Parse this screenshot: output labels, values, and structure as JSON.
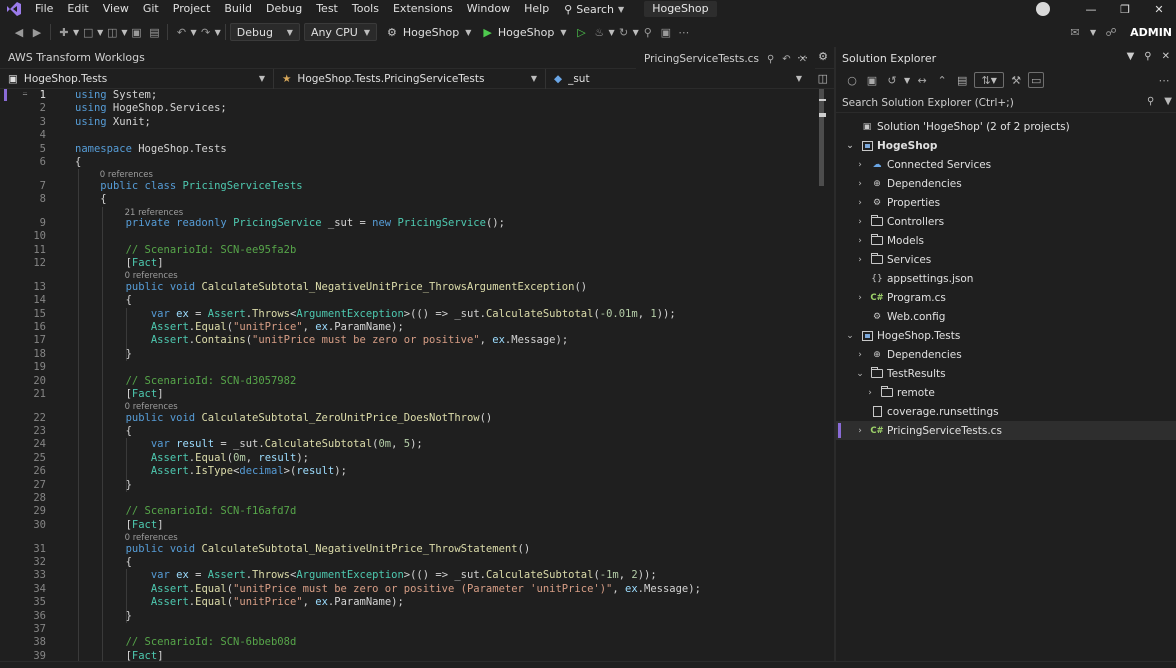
{
  "menu": {
    "items": [
      "File",
      "Edit",
      "View",
      "Git",
      "Project",
      "Build",
      "Debug",
      "Test",
      "Tools",
      "Extensions",
      "Window",
      "Help"
    ],
    "search_label": "Search",
    "solution_title": "HogeShop"
  },
  "toolbar": {
    "config": "Debug",
    "platform": "Any CPU",
    "startup_project": "HogeShop",
    "run_target": "HogeShop",
    "account": "ADMIN"
  },
  "tool_window": {
    "title": "AWS Transform Worklogs",
    "active_tab": "PricingServiceTests.cs"
  },
  "navbar": {
    "project": "HogeShop.Tests",
    "class": "HogeShop.Tests.PricingServiceTests",
    "member": "_sut"
  },
  "editor": {
    "current_line": 1,
    "lines": [
      {
        "n": 1,
        "html": "<span class=\"kw\">using</span> System;"
      },
      {
        "n": 2,
        "html": "<span class=\"kw\">using</span> HogeShop.Services;"
      },
      {
        "n": 3,
        "html": "<span class=\"kw\">using</span> Xunit;"
      },
      {
        "n": 4,
        "html": ""
      },
      {
        "n": 5,
        "html": "<span class=\"kw\">namespace</span> HogeShop.Tests"
      },
      {
        "n": 6,
        "html": "{"
      },
      {
        "n": 7,
        "lens": "0 references",
        "html": "    <span class=\"kw\">public class</span> <span class=\"ty\">PricingServiceTests</span>"
      },
      {
        "n": 8,
        "html": "    {"
      },
      {
        "n": 9,
        "lens": "21 references",
        "html": "        <span class=\"kw\">private readonly</span> <span class=\"ty\">PricingService</span> _sut = <span class=\"kw\">new</span> <span class=\"ty\">PricingService</span>();"
      },
      {
        "n": 10,
        "html": ""
      },
      {
        "n": 11,
        "html": "        <span class=\"cm\">// ScenarioId: SCN-ee95fa2b</span>"
      },
      {
        "n": 12,
        "html": "        [<span class=\"ty\">Fact</span>]"
      },
      {
        "n": 13,
        "lens": "0 references",
        "html": "        <span class=\"kw\">public void</span> <span class=\"me\">CalculateSubtotal_NegativeUnitPrice_ThrowsArgumentException</span>()"
      },
      {
        "n": 14,
        "html": "        {"
      },
      {
        "n": 15,
        "html": "            <span class=\"kw\">var</span> <span class=\"pm\">ex</span> = <span class=\"ty\">Assert</span>.<span class=\"me\">Throws</span>&lt;<span class=\"ty\">ArgumentException</span>&gt;(() =&gt; _sut.<span class=\"me\">CalculateSubtotal</span>(<span class=\"nu\">-0.01m</span>, <span class=\"nu\">1</span>));"
      },
      {
        "n": 16,
        "html": "            <span class=\"ty\">Assert</span>.<span class=\"me\">Equal</span>(<span class=\"st\">\"unitPrice\"</span>, <span class=\"pm\">ex</span>.ParamName);"
      },
      {
        "n": 17,
        "html": "            <span class=\"ty\">Assert</span>.<span class=\"me\">Contains</span>(<span class=\"st\">\"unitPrice must be zero or positive\"</span>, <span class=\"pm\">ex</span>.Message);"
      },
      {
        "n": 18,
        "html": "        }"
      },
      {
        "n": 19,
        "html": ""
      },
      {
        "n": 20,
        "html": "        <span class=\"cm\">// ScenarioId: SCN-d3057982</span>"
      },
      {
        "n": 21,
        "html": "        [<span class=\"ty\">Fact</span>]"
      },
      {
        "n": 22,
        "lens": "0 references",
        "html": "        <span class=\"kw\">public void</span> <span class=\"me\">CalculateSubtotal_ZeroUnitPrice_DoesNotThrow</span>()"
      },
      {
        "n": 23,
        "html": "        {"
      },
      {
        "n": 24,
        "html": "            <span class=\"kw\">var</span> <span class=\"pm\">result</span> = _sut.<span class=\"me\">CalculateSubtotal</span>(<span class=\"nu\">0m</span>, <span class=\"nu\">5</span>);"
      },
      {
        "n": 25,
        "html": "            <span class=\"ty\">Assert</span>.<span class=\"me\">Equal</span>(<span class=\"nu\">0m</span>, <span class=\"pm\">result</span>);"
      },
      {
        "n": 26,
        "html": "            <span class=\"ty\">Assert</span>.<span class=\"me\">IsType</span>&lt;<span class=\"kw\">decimal</span>&gt;(<span class=\"pm\">result</span>);"
      },
      {
        "n": 27,
        "html": "        }"
      },
      {
        "n": 28,
        "html": ""
      },
      {
        "n": 29,
        "html": "        <span class=\"cm\">// ScenarioId: SCN-f16afd7d</span>"
      },
      {
        "n": 30,
        "html": "        [<span class=\"ty\">Fact</span>]"
      },
      {
        "n": 31,
        "lens": "0 references",
        "html": "        <span class=\"kw\">public void</span> <span class=\"me\">CalculateSubtotal_NegativeUnitPrice_ThrowStatement</span>()"
      },
      {
        "n": 32,
        "html": "        {"
      },
      {
        "n": 33,
        "html": "            <span class=\"kw\">var</span> <span class=\"pm\">ex</span> = <span class=\"ty\">Assert</span>.<span class=\"me\">Throws</span>&lt;<span class=\"ty\">ArgumentException</span>&gt;(() =&gt; _sut.<span class=\"me\">CalculateSubtotal</span>(<span class=\"nu\">-1m</span>, <span class=\"nu\">2</span>));"
      },
      {
        "n": 34,
        "html": "            <span class=\"ty\">Assert</span>.<span class=\"me\">Equal</span>(<span class=\"st\">\"unitPrice must be zero or positive (Parameter 'unitPrice')\"</span>, <span class=\"pm\">ex</span>.Message);"
      },
      {
        "n": 35,
        "html": "            <span class=\"ty\">Assert</span>.<span class=\"me\">Equal</span>(<span class=\"st\">\"unitPrice\"</span>, <span class=\"pm\">ex</span>.ParamName);"
      },
      {
        "n": 36,
        "html": "        }"
      },
      {
        "n": 37,
        "html": ""
      },
      {
        "n": 38,
        "html": "        <span class=\"cm\">// ScenarioId: SCN-6bbeb08d</span>"
      },
      {
        "n": 39,
        "html": "        [<span class=\"ty\">Fact</span>]"
      }
    ]
  },
  "solution_explorer": {
    "title": "Solution Explorer",
    "search_placeholder": "Search Solution Explorer (Ctrl+;)",
    "tree": [
      {
        "label": "Solution 'HogeShop' (2 of 2 projects)",
        "depth": 0,
        "icon": "solution",
        "exp": ""
      },
      {
        "label": "HogeShop",
        "depth": 0,
        "icon": "project",
        "exp": "open",
        "bold": true
      },
      {
        "label": "Connected Services",
        "depth": 1,
        "icon": "connected",
        "exp": "closed"
      },
      {
        "label": "Dependencies",
        "depth": 1,
        "icon": "deps",
        "exp": "closed"
      },
      {
        "label": "Properties",
        "depth": 1,
        "icon": "gear",
        "exp": "closed"
      },
      {
        "label": "Controllers",
        "depth": 1,
        "icon": "folder",
        "exp": "closed"
      },
      {
        "label": "Models",
        "depth": 1,
        "icon": "folder",
        "exp": "closed"
      },
      {
        "label": "Services",
        "depth": 1,
        "icon": "folder",
        "exp": "closed"
      },
      {
        "label": "appsettings.json",
        "depth": 1,
        "icon": "json",
        "exp": ""
      },
      {
        "label": "Program.cs",
        "depth": 1,
        "icon": "cs",
        "exp": "closed"
      },
      {
        "label": "Web.config",
        "depth": 1,
        "icon": "config",
        "exp": ""
      },
      {
        "label": "HogeShop.Tests",
        "depth": 0,
        "icon": "testproject",
        "exp": "open"
      },
      {
        "label": "Dependencies",
        "depth": 1,
        "icon": "deps",
        "exp": "closed"
      },
      {
        "label": "TestResults",
        "depth": 1,
        "icon": "folder",
        "exp": "open"
      },
      {
        "label": "remote",
        "depth": 2,
        "icon": "folder",
        "exp": "closed"
      },
      {
        "label": "coverage.runsettings",
        "depth": 1,
        "icon": "file",
        "exp": ""
      },
      {
        "label": "PricingServiceTests.cs",
        "depth": 1,
        "icon": "cs",
        "exp": "closed",
        "selected": true
      }
    ]
  },
  "colors": {
    "accent": "#8a6bd6",
    "background": "#1f1f1f",
    "keyword": "#569cd6",
    "type": "#4ec9b0",
    "method": "#dcdcaa",
    "string": "#d69d85",
    "comment": "#57a64a"
  }
}
